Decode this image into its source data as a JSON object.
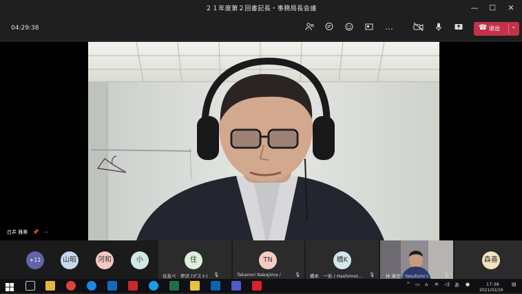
{
  "window": {
    "title": "２１年度第２回書記長・事務局長会議",
    "minimize": "—",
    "maximize": "☐",
    "close": "✕"
  },
  "toolbar": {
    "timer": "04:29:38",
    "leave_label": "退出"
  },
  "stage": {
    "speaker_name": "白井 雅美",
    "pin_icon": "pin-icon",
    "more": "⋯"
  },
  "strip": {
    "more_count": "+11",
    "avatars": [
      {
        "initials": "山昭",
        "color": "#c6d7ef"
      },
      {
        "initials": "河和",
        "color": "#f4c9c1"
      },
      {
        "initials": "小",
        "color": "#cfe8e6"
      }
    ],
    "tiles": [
      {
        "initials": "住",
        "color": "#dcefd8",
        "name": "住友ベ　伊沢 (ゲスト)"
      },
      {
        "initials": "TN",
        "color": "#f6cbc6",
        "name": "Takanori Nakajima /"
      },
      {
        "initials": "橋K",
        "color": "#d4e6ea",
        "name": "橋本　一彩 / Hashimot…"
      },
      {
        "initials": "",
        "color": "",
        "name": "林 康史 / Yasufumi I…"
      },
      {
        "initials": "森善",
        "color": "#f1e3bd",
        "name": ""
      }
    ]
  },
  "taskbar": {
    "ime": "あ",
    "time": "17:38",
    "date": "2021/02/16"
  },
  "colors": {
    "leave": "#c4314b",
    "more_badge": "#6264a7"
  }
}
